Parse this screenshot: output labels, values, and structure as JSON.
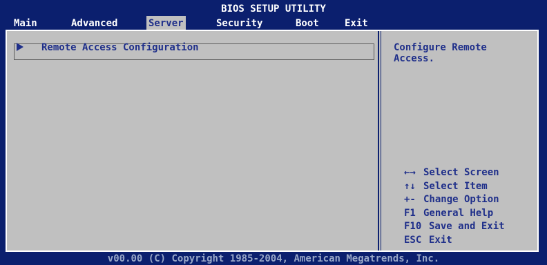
{
  "title": "BIOS SETUP UTILITY",
  "menu": [
    {
      "label": "Main",
      "active": false
    },
    {
      "label": "Advanced",
      "active": false
    },
    {
      "label": "Server",
      "active": true
    },
    {
      "label": "Security",
      "active": false
    },
    {
      "label": "Boot",
      "active": false
    },
    {
      "label": "Exit",
      "active": false
    }
  ],
  "main": {
    "items": [
      {
        "label": "Remote Access Configuration",
        "icon": "submenu-arrow-icon"
      }
    ]
  },
  "help": {
    "text": "Configure Remote\nAccess."
  },
  "keys": [
    {
      "key": "←→",
      "action": "Select Screen"
    },
    {
      "key": "↑↓",
      "action": "Select Item"
    },
    {
      "key": "+-",
      "action": "Change Option"
    },
    {
      "key": "F1",
      "action": "General Help"
    },
    {
      "key": "F10",
      "action": "Save and Exit"
    },
    {
      "key": "ESC",
      "action": "Exit"
    }
  ],
  "footer": "v00.00 (C) Copyright 1985-2004, American Megatrends, Inc.",
  "colors": {
    "background": "#0b1f6e",
    "panel": "#c0c0c0",
    "text_dark": "#1f2f8a",
    "text_light": "#ffffff"
  }
}
